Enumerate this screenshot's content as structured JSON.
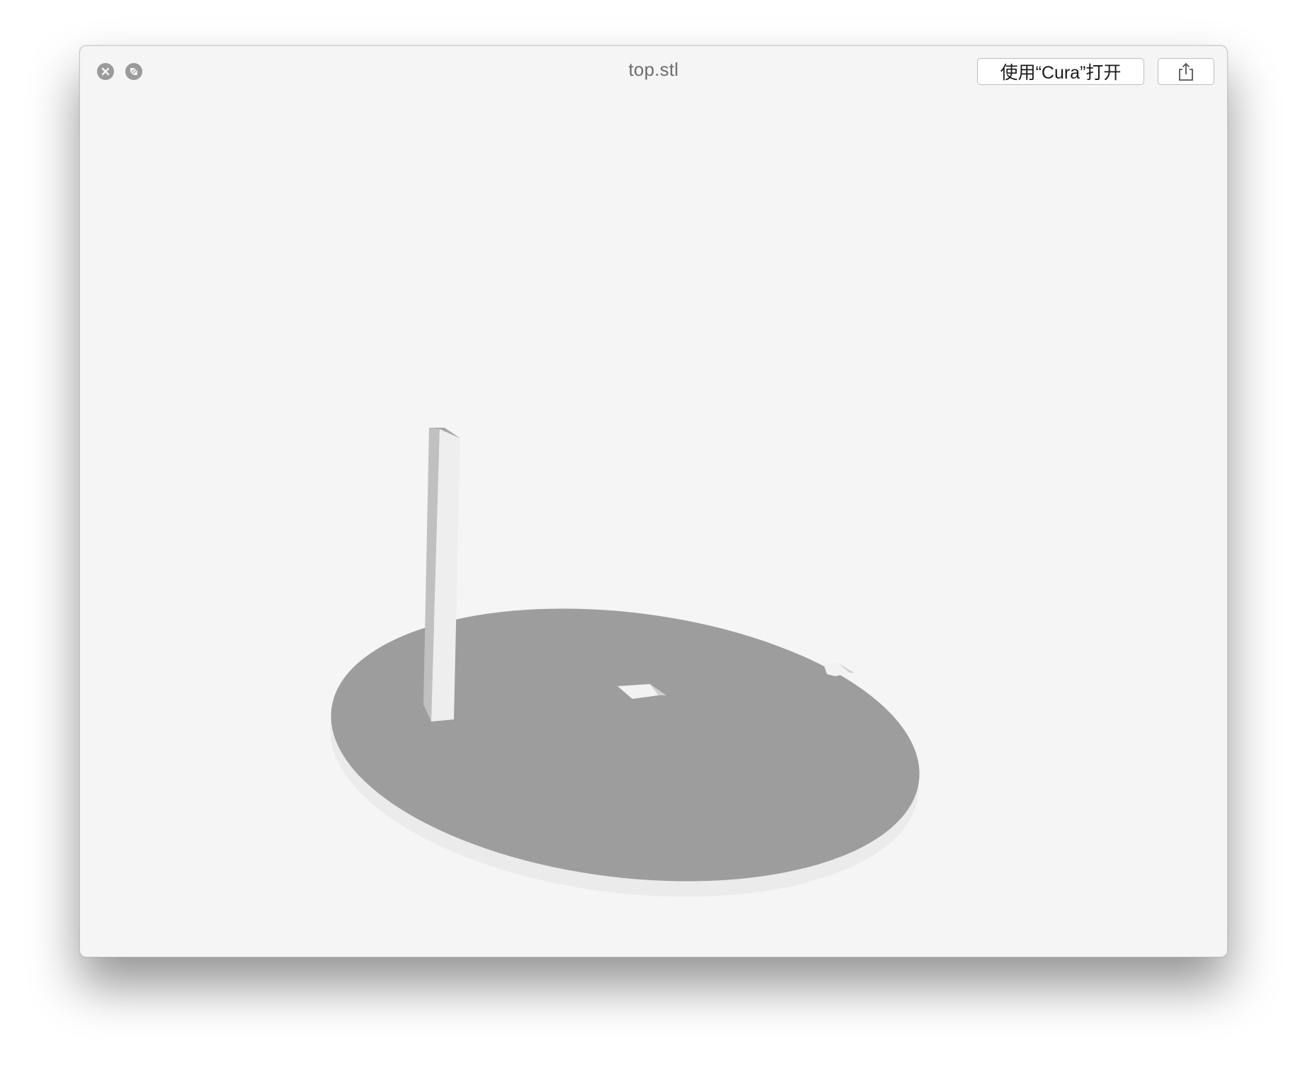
{
  "window": {
    "title": "top.stl",
    "open_with_label": "使用“Cura”打开"
  },
  "icons": {
    "close": "close-icon",
    "fullscreen": "fullscreen-icon",
    "share": "share-icon"
  },
  "colors": {
    "background": "#f5f5f5",
    "model_surface": "#9d9d9d",
    "model_edge": "#ebebeb"
  }
}
